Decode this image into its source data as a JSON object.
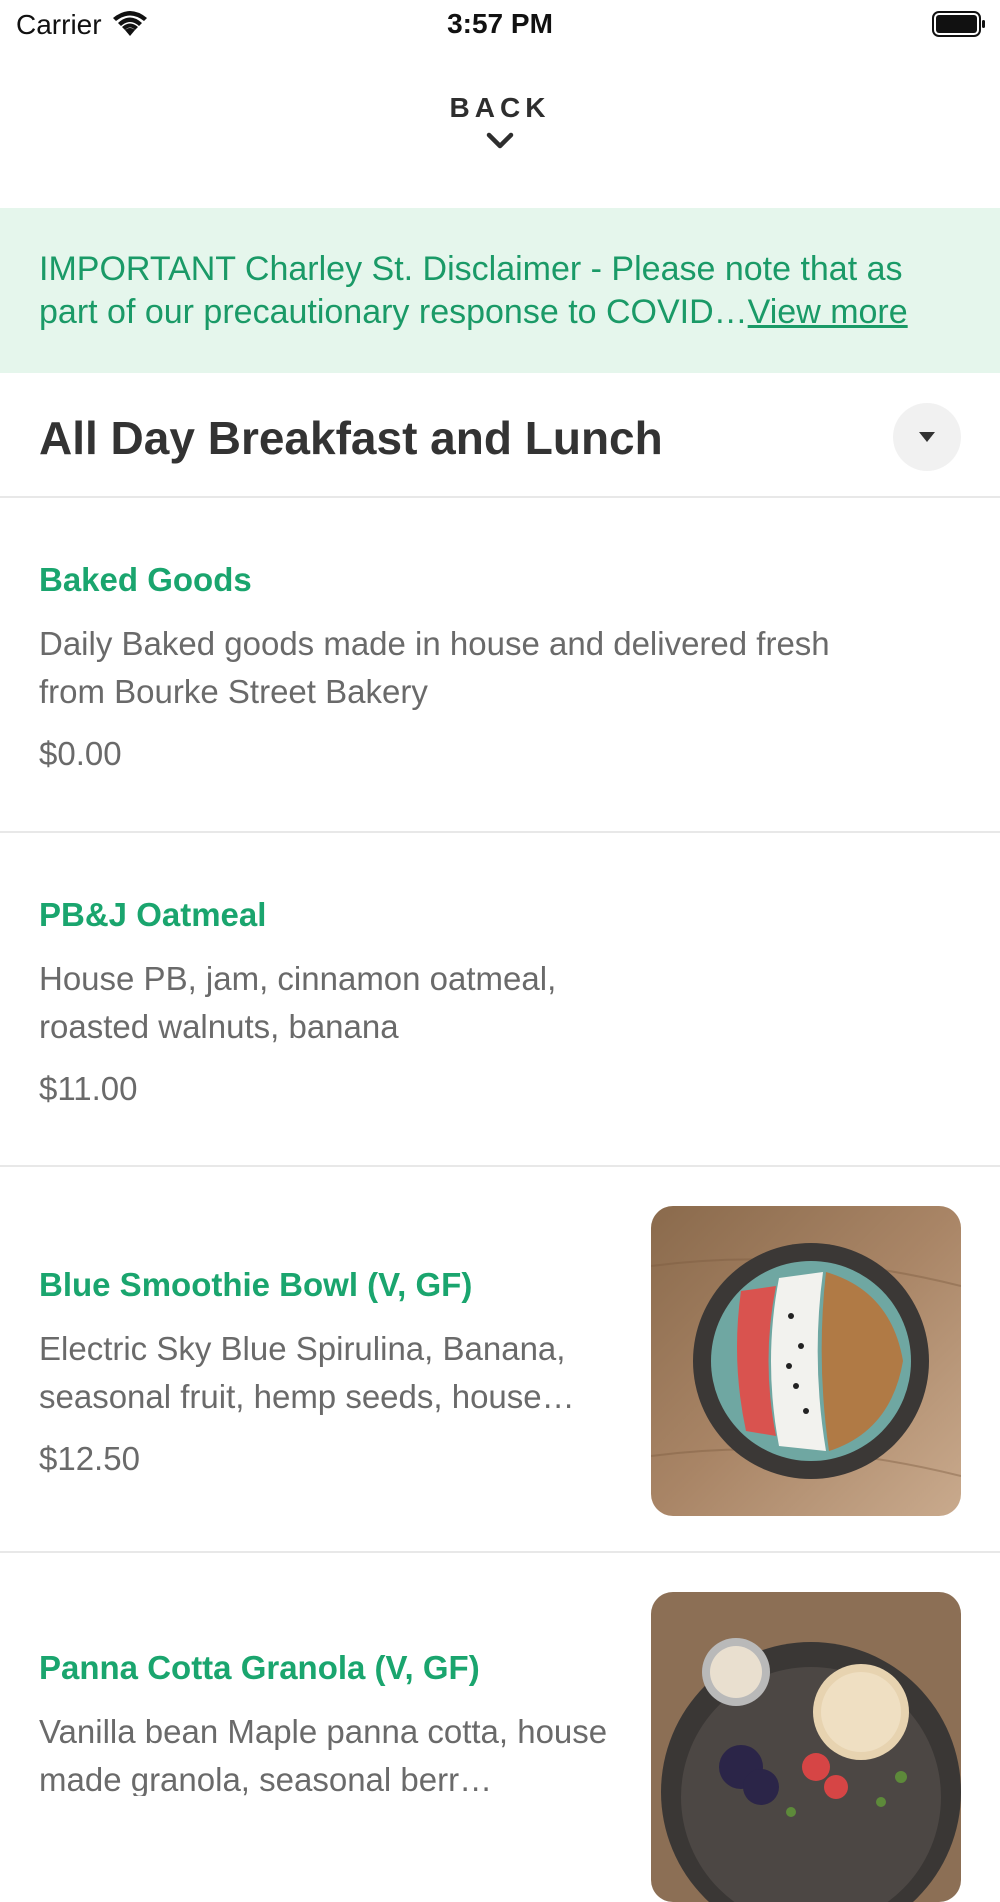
{
  "status_bar": {
    "carrier": "Carrier",
    "time": "3:57 PM",
    "icons": [
      "wifi-icon",
      "battery-icon"
    ]
  },
  "nav": {
    "back_label": "BACK",
    "back_icon": "chevron-down-icon"
  },
  "disclaimer": {
    "text": "IMPORTANT Charley St. Disclaimer - Please note that as part of our precautionary response to COVID…",
    "link_label": "View more",
    "background": "#e5f6ec",
    "text_color": "#1a9a67"
  },
  "section": {
    "title": "All Day Breakfast and Lunch",
    "toggle_icon": "caret-down-icon"
  },
  "items": [
    {
      "name": "Baked Goods",
      "description": "Daily Baked goods made in house and delivered fresh from Bourke Street Bakery",
      "price": "$0.00"
    },
    {
      "name": "PB&J Oatmeal",
      "description": "House PB, jam, cinnamon oatmeal, roasted walnuts, banana",
      "price": "$11.00"
    },
    {
      "name": "Blue Smoothie Bowl (V, GF)",
      "description": "Electric Sky Blue Spirulina, Banana, seasonal fruit, hemp seeds, house…",
      "price": "$12.50",
      "image": "smoothie-bowl-photo"
    },
    {
      "name": "Panna Cotta Granola (V, GF)",
      "description": "Vanilla bean Maple panna cotta, house made granola, seasonal berr…",
      "image": "panna-cotta-photo"
    }
  ],
  "colors": {
    "accent": "#1aa56e",
    "muted_text": "#6a6a6a",
    "divider": "#e8e8e8"
  }
}
